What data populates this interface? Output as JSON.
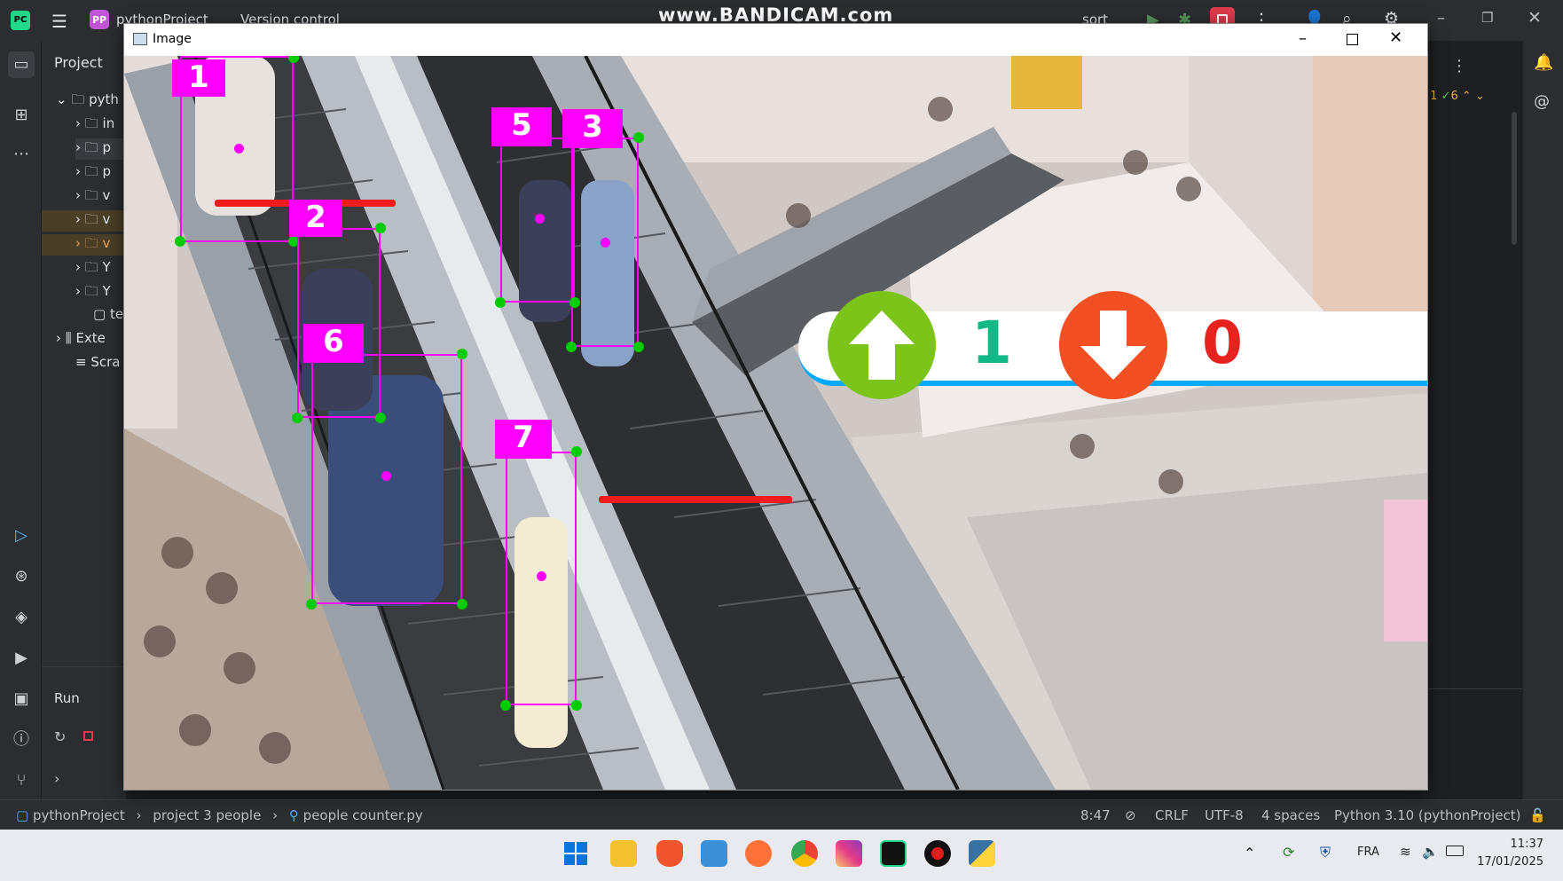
{
  "ide": {
    "project_badge": "PP",
    "project_name": "pythonProject",
    "version_control": "Version control",
    "run_config": "sort",
    "project_panel_title": "Project",
    "run_label": "Run",
    "tree": [
      {
        "label": "pyth",
        "kind": "folder-open"
      },
      {
        "label": "in",
        "kind": "folder"
      },
      {
        "label": "p",
        "kind": "folder"
      },
      {
        "label": "p",
        "kind": "folder"
      },
      {
        "label": "v",
        "kind": "folder"
      },
      {
        "label": "v",
        "kind": "folder"
      },
      {
        "label": "v",
        "kind": "folder-orange"
      },
      {
        "label": "Y",
        "kind": "folder"
      },
      {
        "label": "Y",
        "kind": "folder"
      },
      {
        "label": "te",
        "kind": "file"
      },
      {
        "label": "Exte",
        "kind": "library"
      },
      {
        "label": "Scra",
        "kind": "scratch"
      }
    ],
    "inspections": {
      "warnings": "1",
      "checks": "6"
    }
  },
  "recorder_watermark": "www.BANDICAM.com",
  "image_window": {
    "title": "Image"
  },
  "counter": {
    "up_count": "1",
    "down_count": "0",
    "up_color": "#7cc41a",
    "down_color": "#f25022",
    "up_text_color": "#12b886",
    "down_text_color": "#e8231f"
  },
  "tracks": [
    {
      "id": "1",
      "label": "1"
    },
    {
      "id": "2",
      "label": "2"
    },
    {
      "id": "3",
      "label": "3"
    },
    {
      "id": "5",
      "label": "5"
    },
    {
      "id": "6",
      "label": "6"
    },
    {
      "id": "7",
      "label": "7"
    }
  ],
  "status": {
    "breadcrumb": [
      "pythonProject",
      "project 3 people",
      "people counter.py"
    ],
    "position": "8:47",
    "line_sep": "CRLF",
    "encoding": "UTF-8",
    "indent": "4 spaces",
    "interpreter": "Python 3.10 (pythonProject)"
  },
  "taskbar": {
    "language": "FRA",
    "time": "11:37",
    "date": "17/01/2025"
  },
  "colors": {
    "box": "#ff00ff",
    "corner": "#00cc00",
    "line": "#ee1c1c"
  }
}
